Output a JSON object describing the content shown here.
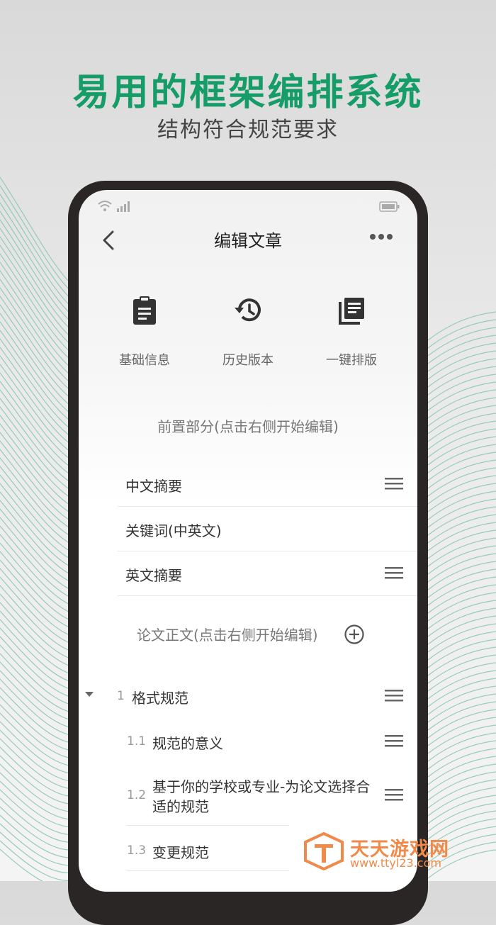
{
  "hero": {
    "title": "易用的框架编排系统",
    "subtitle": "结构符合规范要求"
  },
  "nav": {
    "title": "编辑文章",
    "back_icon": "chevron-left-icon",
    "more_icon": "more-horizontal-icon"
  },
  "toolbar": {
    "items": [
      {
        "label": "基础信息",
        "icon": "clipboard-icon"
      },
      {
        "label": "历史版本",
        "icon": "history-icon"
      },
      {
        "label": "一键排版",
        "icon": "layers-icon"
      }
    ]
  },
  "front_section": {
    "title": "前置部分(点击右侧开始编辑)",
    "rows": [
      {
        "label": "中文摘要",
        "has_handle": true
      },
      {
        "label": "关键词(中英文)",
        "has_handle": false
      },
      {
        "label": "英文摘要",
        "has_handle": true
      }
    ]
  },
  "body_section": {
    "title": "论文正文(点击右侧开始编辑)",
    "chapters": [
      {
        "num": "1",
        "label": "格式规范"
      }
    ],
    "subitems": [
      {
        "num": "1.1",
        "label": "规范的意义"
      },
      {
        "num": "1.2",
        "label_line1": "基于你的学校或专业-为论文选择合",
        "label_line2": "适的规范"
      },
      {
        "num": "1.3",
        "label": "变更规范"
      }
    ]
  },
  "watermark": {
    "name": "天天游戏网",
    "url": "www.ttyl23.com"
  },
  "colors": {
    "brand_green": "#169c67",
    "watermark_orange": "#f08a4b"
  }
}
